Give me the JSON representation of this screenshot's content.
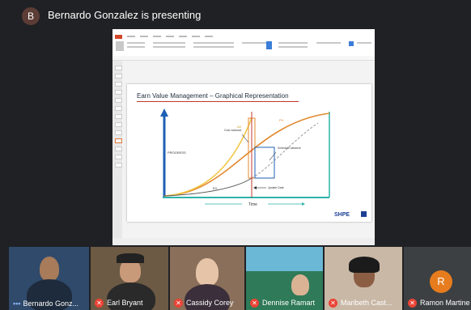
{
  "presenter": {
    "initial": "B",
    "text": "Bernardo Gonzalez is presenting"
  },
  "slide": {
    "title": "Earn Value Management – Graphical Representation",
    "labels": {
      "progress": "PROGRESS",
      "time": "Time",
      "cost_variance": "Cost variance",
      "schedule_variance": "Schedule variance",
      "update_date": "Update Date",
      "pv": "PV",
      "ac": "AC",
      "ev": "EV"
    },
    "logo": "SHPE"
  },
  "participants": [
    {
      "name": "Bernardo Gonz...",
      "muted": false,
      "speaking": true,
      "bg": "#2f4a6b"
    },
    {
      "name": "Earl Bryant",
      "muted": true,
      "speaking": false,
      "bg": "#6d5a44"
    },
    {
      "name": "Cassidy Corey",
      "muted": true,
      "speaking": false,
      "bg": "#8a6f5a"
    },
    {
      "name": "Dennise Ramart",
      "muted": true,
      "speaking": false,
      "bg": "#3b8a8e"
    },
    {
      "name": "Maribeth Cast...",
      "muted": true,
      "speaking": false,
      "bg": "#c9b8a6"
    },
    {
      "name": "Ramon Martine",
      "muted": true,
      "speaking": false,
      "bg": "#3c4043",
      "initial": "R"
    }
  ],
  "colors": {
    "accent_red": "#ea4335",
    "avatar_orange": "#e67c1e",
    "ppt_orange": "#d24726",
    "curve_orange": "#e3892f",
    "curve_yellow": "#f0c542",
    "teal": "#2bb3a8"
  }
}
